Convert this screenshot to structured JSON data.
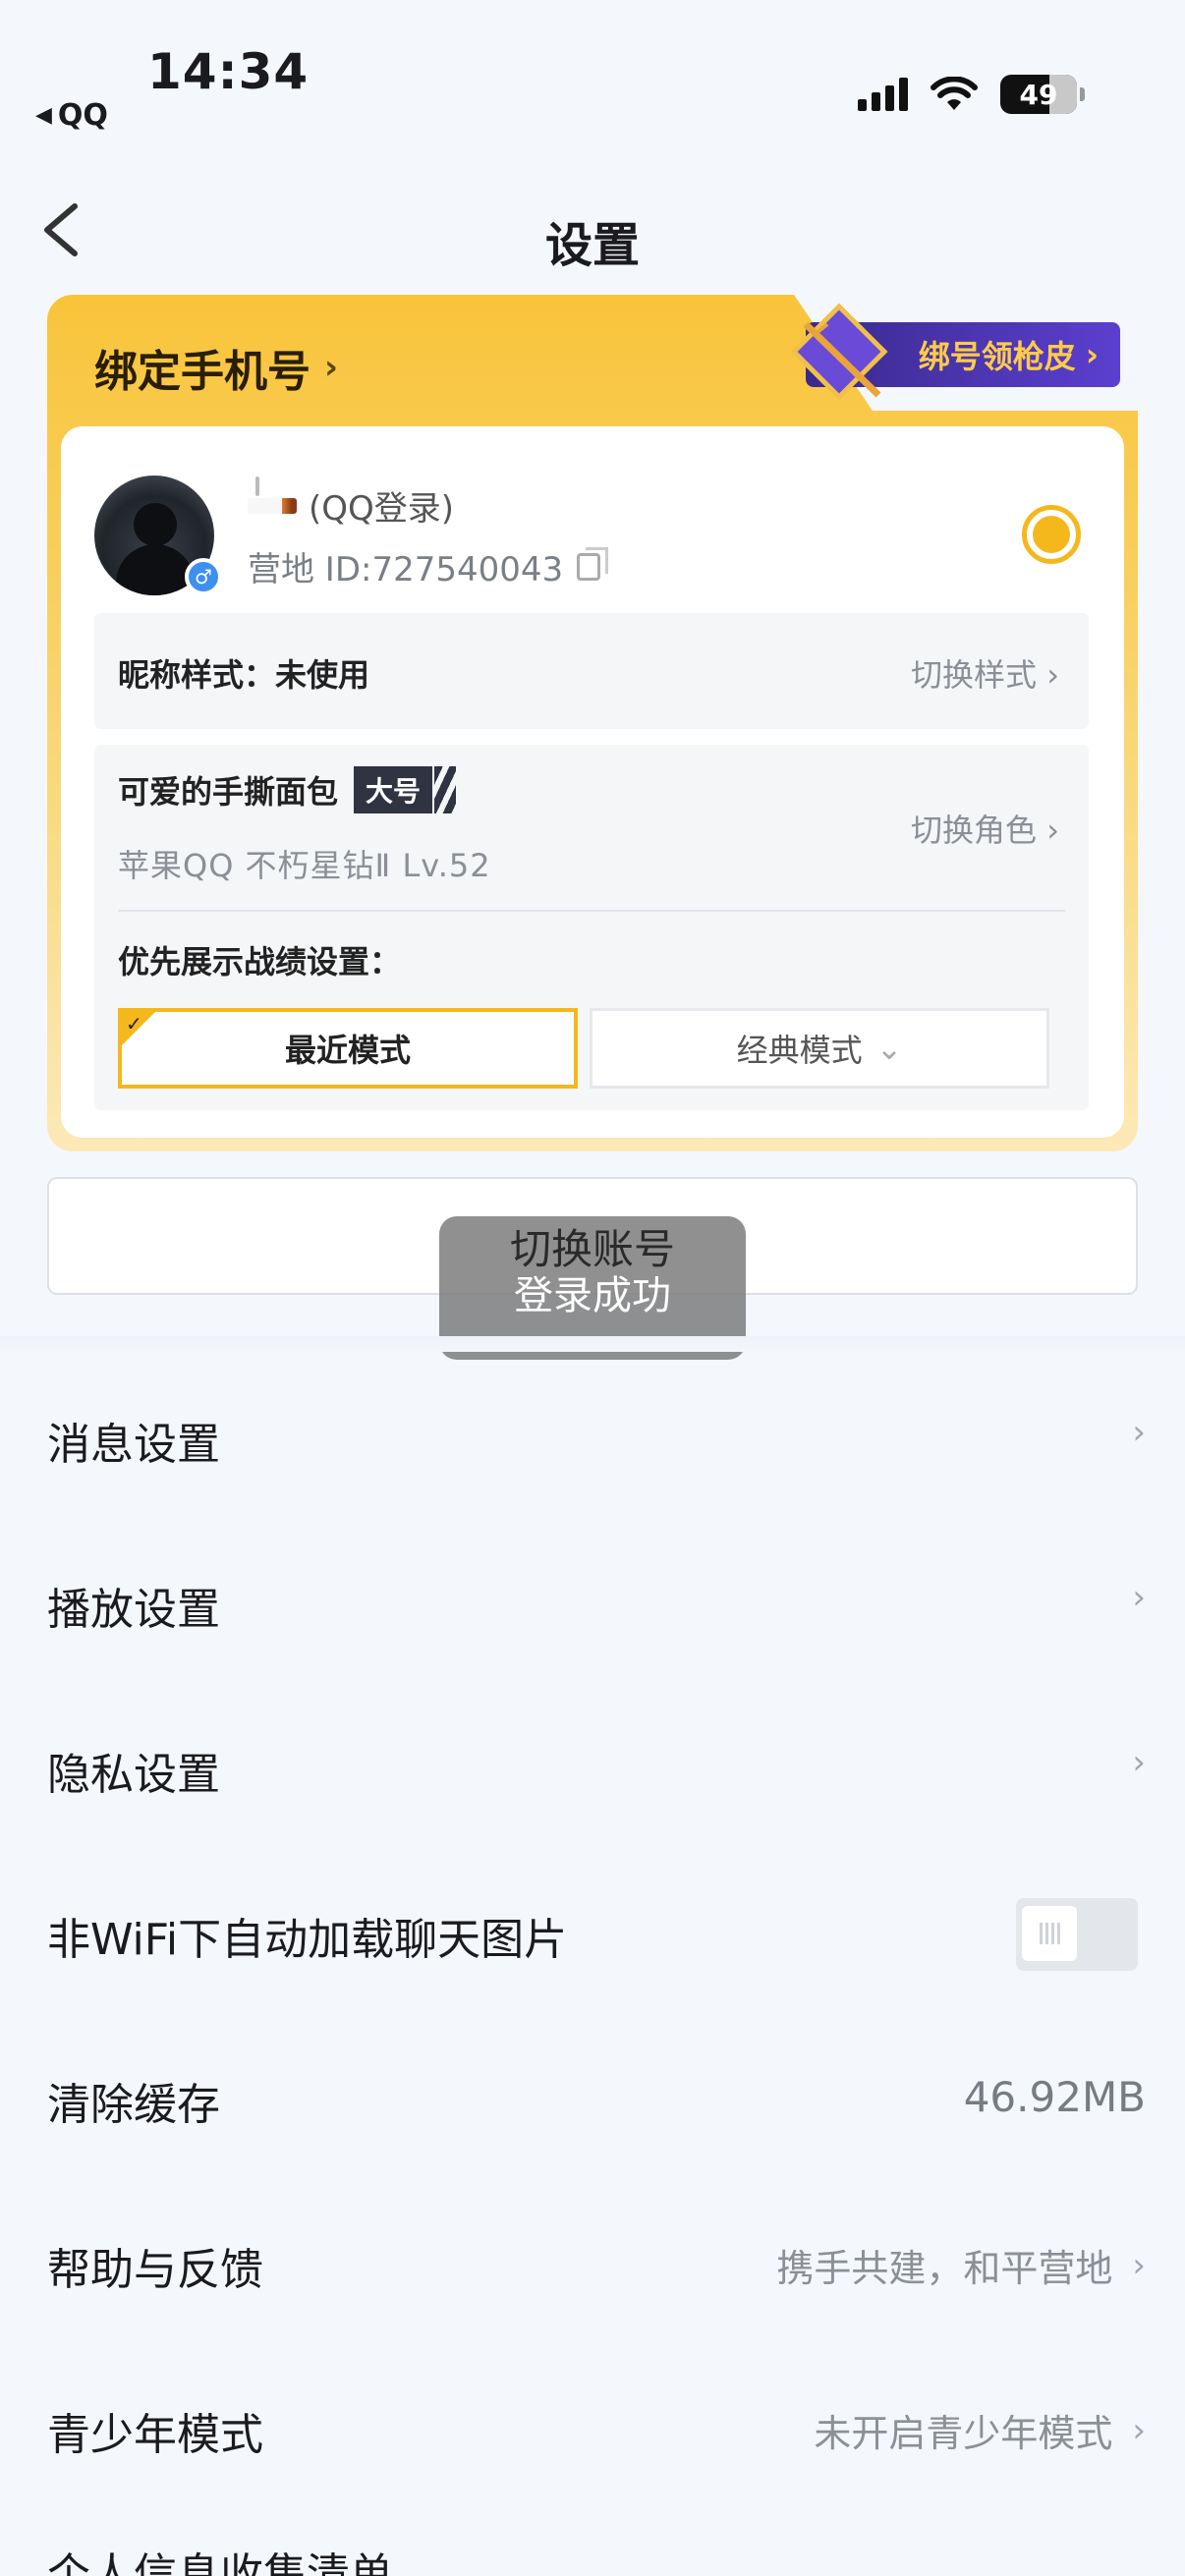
{
  "status_bar": {
    "time": "14:34",
    "back_app": "QQ",
    "battery": "49"
  },
  "nav": {
    "title": "设置"
  },
  "bind_card": {
    "title": "绑定手机号",
    "promo_label": "绑号领枪皮",
    "user": {
      "name_suffix": "(QQ登录)",
      "id": "营地 ID:727540043"
    },
    "nickname_style": {
      "label": "昵称样式：未使用",
      "action": "切换样式"
    },
    "role": {
      "name": "可爱的手撕面包",
      "tag": "大号",
      "subtitle": "苹果QQ  不朽星钻Ⅱ  Lv.52",
      "action": "切换角色"
    },
    "priority": {
      "label": "优先展示战绩设置：",
      "mode_recent": "最近模式",
      "mode_classic": "经典模式"
    }
  },
  "toast": {
    "title": "切换账号",
    "message": "登录成功"
  },
  "menu": [
    {
      "label": "消息设置"
    },
    {
      "label": "播放设置"
    },
    {
      "label": "隐私设置"
    },
    {
      "label": "非WiFi下自动加载聊天图片"
    },
    {
      "label": "清除缓存",
      "value": "46.92MB"
    },
    {
      "label": "帮助与反馈",
      "value": "携手共建，和平营地"
    },
    {
      "label": "青少年模式",
      "value": "未开启青少年模式"
    }
  ],
  "cut_off_item": "个人信息收集清单"
}
